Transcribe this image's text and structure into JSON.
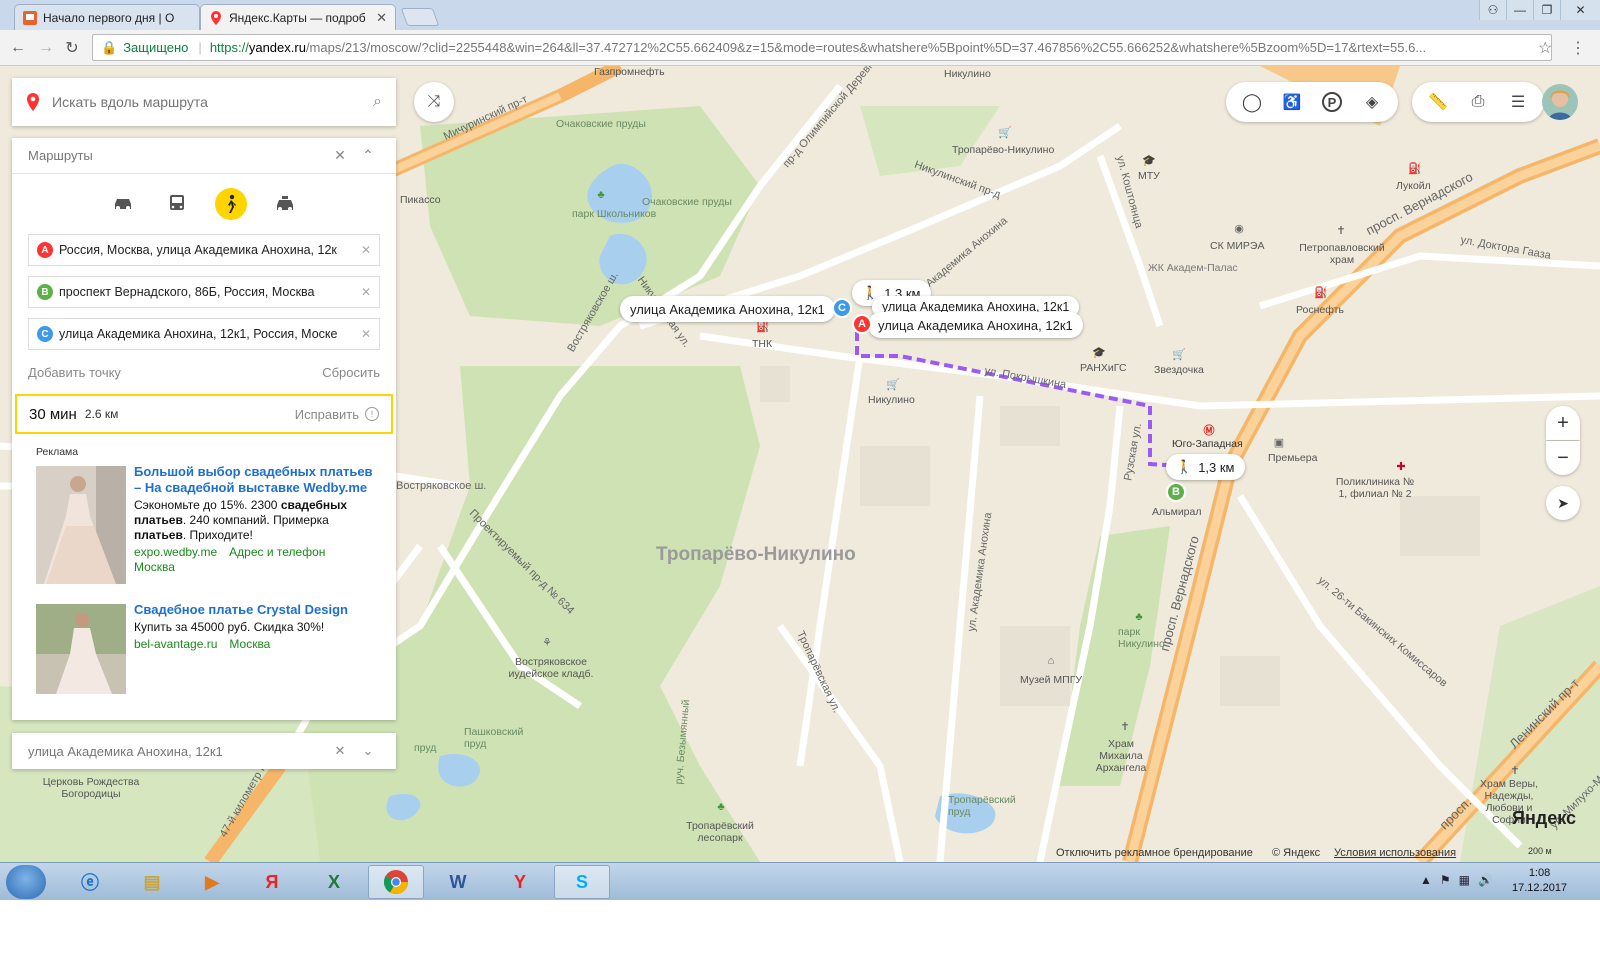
{
  "browser": {
    "tabs": [
      {
        "title": "Начало первого дня | О",
        "active": false
      },
      {
        "title": "Яндекс.Карты — подроб",
        "active": true
      }
    ],
    "secure_label": "Защищено",
    "url_scheme": "https://",
    "url_host": "yandex.ru",
    "url_path": "/maps/213/moscow/?clid=2255448&win=264&ll=37.472712%2C55.662409&z=15&mode=routes&whatshere%5Bpoint%5D=37.467856%2C55.666252&whatshere%5Bzoom%5D=17&rtext=55.6..."
  },
  "search": {
    "placeholder": "Искать вдоль маршрута"
  },
  "routes": {
    "title": "Маршруты",
    "waypoints": [
      {
        "letter": "A",
        "color": "#f33",
        "text": "Россия, Москва, улица Академика Анохина, 12к"
      },
      {
        "letter": "B",
        "color": "#5cb146",
        "text": "проспект Вернадского, 86Б, Россия, Москва"
      },
      {
        "letter": "C",
        "color": "#3d9aea",
        "text": "улица Академика Анохина, 12к1, Россия, Моске"
      }
    ],
    "add_point": "Добавить точку",
    "reset": "Сбросить",
    "result_time": "30 мин",
    "result_distance": "2.6 км",
    "fix": "Исправить"
  },
  "ads": {
    "header": "Реклама",
    "items": [
      {
        "headline": "Большой выбор свадебных платьев – На свадебной выставке Wedby.me",
        "desc_a": "Сэкономьте до 15%. 2300 ",
        "desc_b": "свадебных платьев",
        "desc_c": ". 240 компаний. Примерка ",
        "desc_d": "платьев",
        "desc_e": ". Приходите!",
        "link1": "expo.wedby.me",
        "link2": "Адрес и телефон",
        "link3": "Москва"
      },
      {
        "headline": "Свадебное платье Crystal Design",
        "desc": "Купить за 45000 руб. Скидка 30%!",
        "link1": "bel-avantage.ru",
        "link2": "Москва"
      }
    ]
  },
  "bottom_box": {
    "text": "улица Академика Анохина, 12к1"
  },
  "map": {
    "district": "Тропарёво-Никулино",
    "route_color": "#9b59f5",
    "bubbles": {
      "walk1": "1,3 км",
      "walk2": "1,3 км",
      "c_label": "улица Академика Анохина, 12к1",
      "c_label2": "улица Академика Анохина, 12к1",
      "a_label": "улица Академика Анохина, 12к1"
    },
    "labels": {
      "gazprom": "Газпромнефть",
      "michurinsky": "Мичуринский пр-т",
      "olimp": "пр-д Олимпийской Деревни",
      "ochakovo1": "Очаковские пруды",
      "ochakovo2": "Очаковские пруды",
      "pikasso": "Пикассо",
      "park_shk": "парк Школьников",
      "nikulino_top": "Никулино",
      "troparevo_nik": "Тропарёво-Никулино",
      "koshtoyantsa": "ул. Коштоянца",
      "mtu": "МТУ",
      "lukoil": "Лукойл",
      "vernadsk_top": "просп. Вернадского",
      "nikulinsky": "Никулинский пр-д",
      "anokhina_top": "ул. Академика Анохина",
      "sk_mirea": "СК МИРЭА",
      "zhk": "ЖК Академ-Палас",
      "petro": "Петропавловский храм",
      "gaaza": "ул. Доктора Гааза",
      "rosneft": "Роснефть",
      "tnk": "ТНК",
      "vostryak_sh": "Востряковское ш.",
      "nikulinskaya": "Никулинская ул.",
      "ranhigs": "РАНХиГС",
      "zvezdochka": "Звездочка",
      "pokryshkina": "ул. Покрышкина",
      "nikulino_mid": "Никулино",
      "yugo_zap": "Юго-Западная",
      "premiera": "Премьера",
      "poliklinika": "Поликлиника № 1, филиал № 2",
      "almiral": "Альмирал",
      "russkaya": "Рузская ул.",
      "vostryak_sh2": "Востряковское ш.",
      "proektiruemy": "Проектируемый пр-д № 634",
      "anokhina_mid": "ул. Академика Анохина",
      "vernadsk_mid": "просп. Вернадского",
      "bakinskih": "ул. 26-ти Бакинских Комиссаров",
      "leninsky": "Ленинский пр-т",
      "park_nik": "парк Никулино",
      "muzey": "Музей МПГУ",
      "troparevskaya": "Тропарёвская ул.",
      "vostr_kladb": "Востряковское иудейское кладб.",
      "pashkovsky": "Пашковский пруд",
      "ruch": "руч. Безымянный",
      "khram_mikh": "Храм Михаила Архангела",
      "trop_prud": "Тропарёвский пруд",
      "vostr_prud": "пруд",
      "tserkov": "Церковь Рождества Богородицы",
      "kilometer": "47-й километр МКАД",
      "trop_lesopark": "Тропарёвский лесопарк",
      "khram_vera": "Храм Веры, Надежды, Любови и Софии",
      "milukho": "ул. Милухо-Маклая",
      "prosp_bottom": "просп.",
      "zdanie_sk": "Академическая ул."
    }
  },
  "footer": {
    "branding_off": "Отключить рекламное брендирование",
    "copyright": "© Яндекс",
    "terms": "Условия использования",
    "logo": "Яндекс",
    "scale": "200 м"
  },
  "taskbar": {
    "time": "1:08",
    "date": "17.12.2017",
    "yandex_letter": "Я",
    "excel_letter": "X",
    "word_letter": "W",
    "yabrowser_letter": "Y",
    "skype_letter": "S"
  }
}
